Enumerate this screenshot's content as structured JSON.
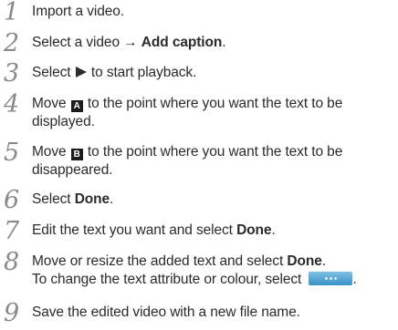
{
  "steps": [
    {
      "number": "1",
      "text": "Import a video."
    },
    {
      "number": "2",
      "text_before": "Select a video → ",
      "bold": "Add caption",
      "text_after": "."
    },
    {
      "number": "3",
      "text_before": "Select ",
      "icon": "play-icon",
      "text_after": " to start playback."
    },
    {
      "number": "4",
      "text_before": "Move ",
      "marker": "A",
      "text_after": " to the point where you want the text to be displayed."
    },
    {
      "number": "5",
      "text_before": "Move ",
      "marker": "B",
      "text_after": " to the point where you want the text to be disappeared."
    },
    {
      "number": "6",
      "text_before": "Select ",
      "bold": "Done",
      "text_after": "."
    },
    {
      "number": "7",
      "text_before": "Edit the text you want and select ",
      "bold": "Done",
      "text_after": "."
    },
    {
      "number": "8",
      "text_before": "Move or resize the added text and select ",
      "bold": "Done",
      "text_after": ".",
      "line2_before": "To change the text attribute or colour, select ",
      "line2_icon": "more-options-button-icon",
      "line2_after": "."
    },
    {
      "number": "9",
      "text": "Save the edited video with a new file name."
    }
  ]
}
